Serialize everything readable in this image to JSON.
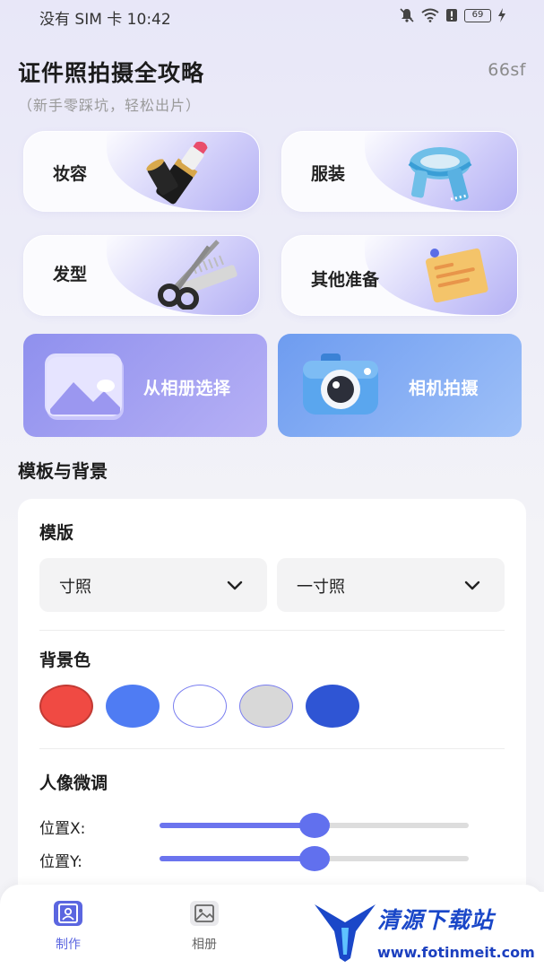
{
  "status_bar": {
    "left_text": "没有 SIM 卡 10:42",
    "battery_level": "69",
    "icons": [
      "mute-bell-icon",
      "wifi-icon",
      "alert-icon",
      "battery-icon",
      "charging-icon"
    ]
  },
  "header": {
    "title": "证件照拍摄全攻略",
    "user_tag": "66sf",
    "subtitle": "（新手零踩坑，轻松出片）"
  },
  "guides": [
    {
      "label": "妆容",
      "icon": "lipstick-icon"
    },
    {
      "label": "服装",
      "icon": "scarf-icon"
    },
    {
      "label": "发型",
      "icon": "scissors-comb-icon"
    },
    {
      "label": "其他准备",
      "icon": "note-icon"
    }
  ],
  "actions": {
    "album": {
      "label": "从相册选择",
      "icon": "photo-album-icon"
    },
    "camera": {
      "label": "相机拍摄",
      "icon": "camera-icon"
    }
  },
  "section_title": "模板与背景",
  "template": {
    "heading": "模版",
    "category_value": "寸照",
    "size_value": "一寸照"
  },
  "background": {
    "heading": "背景色",
    "colors": [
      "#f04a43",
      "#4f7cf3",
      "#ffffff",
      "#d8d8d8",
      "#2f55d4"
    ],
    "selected_index": 0
  },
  "portrait": {
    "heading": "人像微调",
    "x_label": "位置X:",
    "y_label": "位置Y:",
    "x_value": 0.5,
    "y_value": 0.5,
    "slider_color": "#6170ee"
  },
  "tabbar": {
    "tabs": [
      {
        "label": "制作",
        "icon": "portrait-id-icon",
        "active": true
      },
      {
        "label": "相册",
        "icon": "gallery-icon",
        "active": false
      }
    ],
    "active_color": "#5b66e0",
    "inactive_color": "#666666"
  },
  "watermark": {
    "text": "清源下载站",
    "url": "www.fotinmeit.com"
  }
}
